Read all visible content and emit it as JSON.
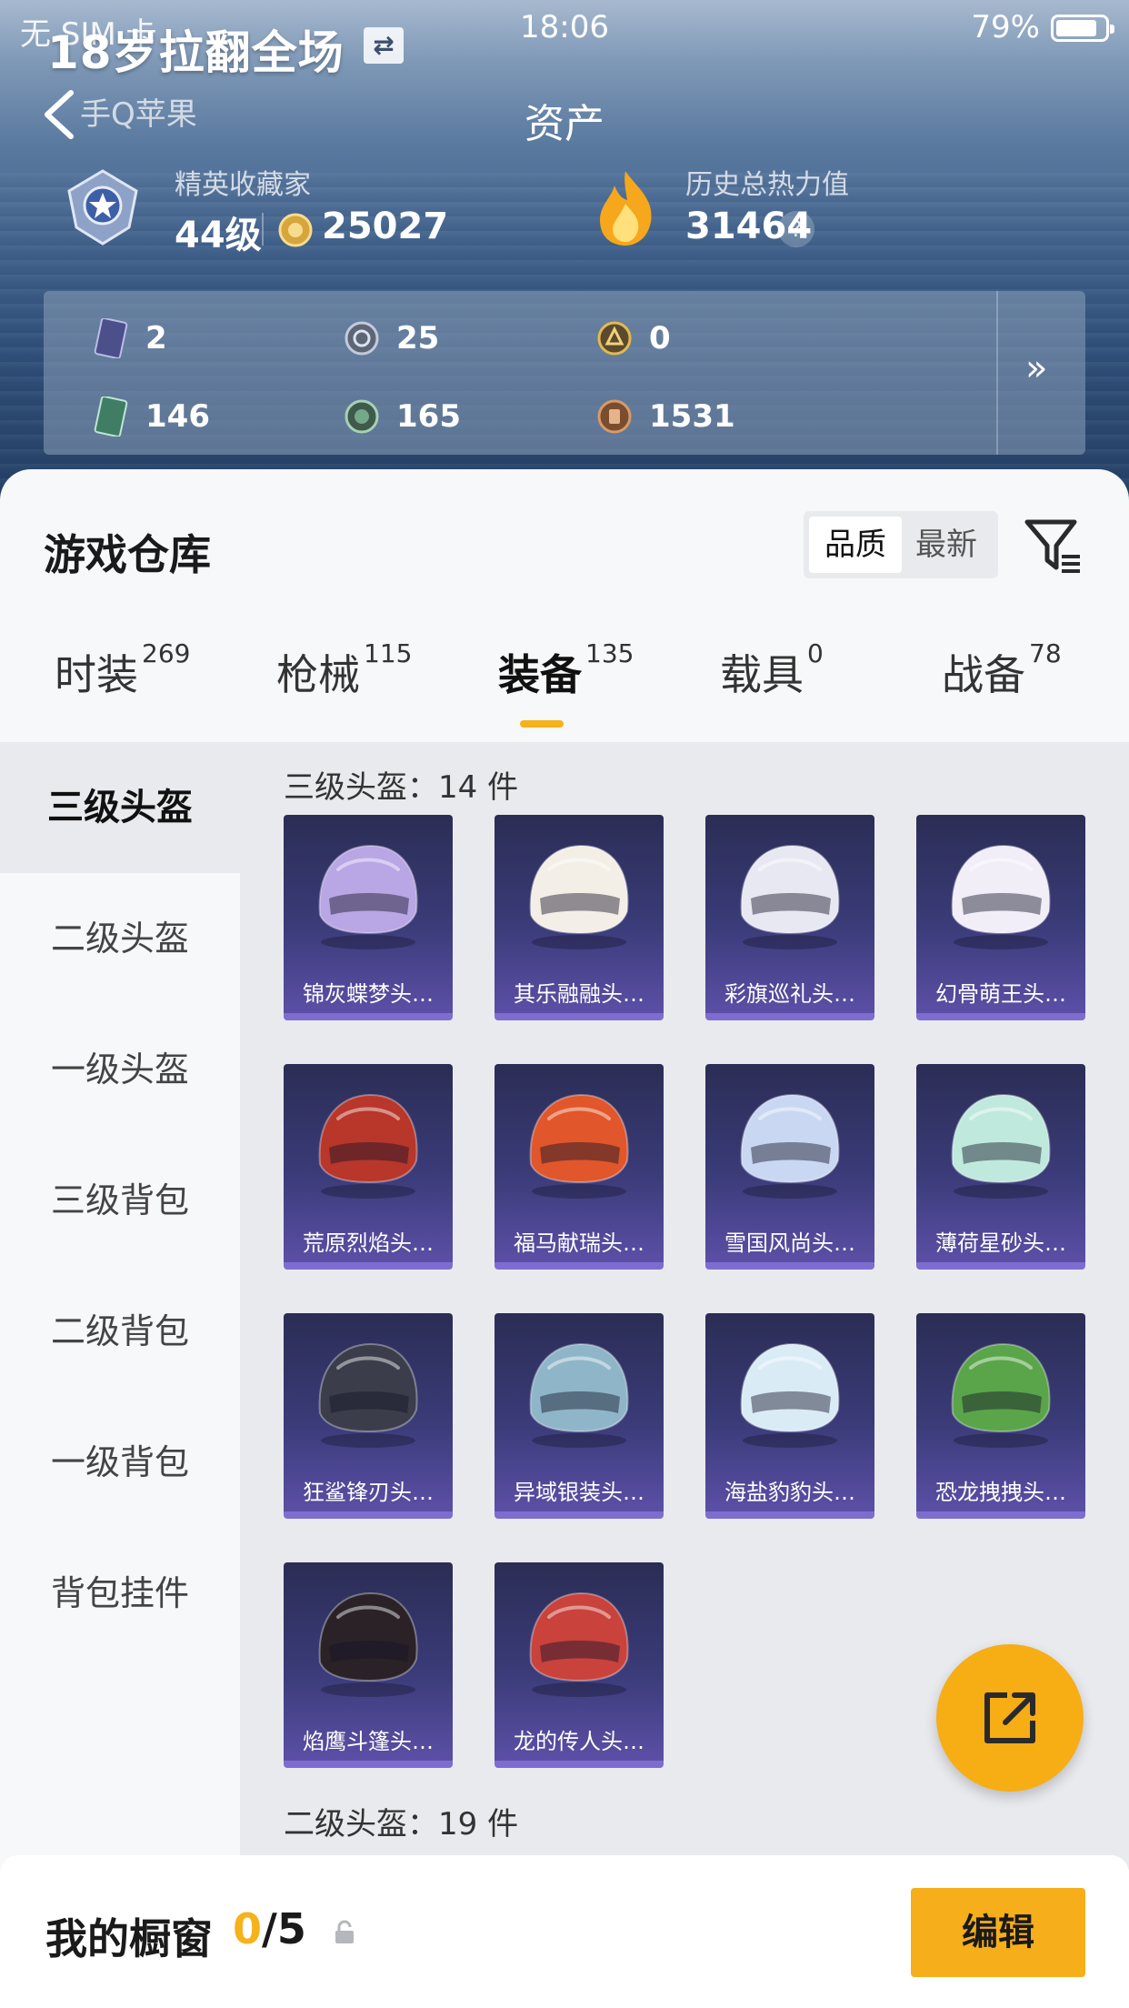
{
  "status_bar": {
    "carrier": "无 SIM 卡",
    "time": "18:06",
    "battery_pct": "79%",
    "battery_level": 0.79
  },
  "header": {
    "player_name": "18岁拉翻全场",
    "sub_platform": "手Q苹果",
    "sub_server": "",
    "page_title": "资产"
  },
  "rank": {
    "label": "精英收藏家",
    "level": "44级",
    "coins": "25027"
  },
  "heat": {
    "label": "历史总热力值",
    "value": "31464",
    "help": "?"
  },
  "currencies": [
    {
      "icon": "purple-card-icon",
      "value": "2"
    },
    {
      "icon": "silver-coin-icon",
      "value": "25"
    },
    {
      "icon": "gold-coin-icon",
      "value": "0"
    },
    {
      "icon": "green-card-icon",
      "value": "146"
    },
    {
      "icon": "green-coin-icon",
      "value": "165"
    },
    {
      "icon": "bronze-coin-icon",
      "value": "1531"
    }
  ],
  "more_arrows": "»",
  "warehouse": {
    "title": "游戏仓库",
    "sort_options": [
      "品质",
      "最新"
    ],
    "active_sort": "品质"
  },
  "tabs": [
    {
      "label": "时装",
      "count": "269"
    },
    {
      "label": "枪械",
      "count": "115"
    },
    {
      "label": "装备",
      "count": "135",
      "active": true
    },
    {
      "label": "载具",
      "count": "0"
    },
    {
      "label": "战备",
      "count": "78"
    }
  ],
  "sidebar": {
    "items": [
      {
        "label": "三级头盔",
        "active": true
      },
      {
        "label": "二级头盔"
      },
      {
        "label": "一级头盔"
      },
      {
        "label": "三级背包"
      },
      {
        "label": "二级背包"
      },
      {
        "label": "一级背包"
      },
      {
        "label": "背包挂件"
      }
    ]
  },
  "sections": [
    {
      "title": "三级头盔：14 件"
    },
    {
      "title": "二级头盔：19 件"
    }
  ],
  "items": [
    {
      "name": "锦灰蝶梦头…",
      "color": "#b9a6e4"
    },
    {
      "name": "其乐融融头…",
      "color": "#f3efe6"
    },
    {
      "name": "彩旗巡礼头…",
      "color": "#e8e8f2"
    },
    {
      "name": "幻骨萌王头…",
      "color": "#f1eef8"
    },
    {
      "name": "荒原烈焰头…",
      "color": "#b8362a"
    },
    {
      "name": "福马献瑞头…",
      "color": "#e1562a"
    },
    {
      "name": "雪国风尚头…",
      "color": "#c9d7f3"
    },
    {
      "name": "薄荷星砂头…",
      "color": "#bfe9dc"
    },
    {
      "name": "狂鲨锋刃头…",
      "color": "#3b3e4a"
    },
    {
      "name": "异域银装头…",
      "color": "#8fb6c8"
    },
    {
      "name": "海盐豹豹头…",
      "color": "#d9ecf6"
    },
    {
      "name": "恐龙拽拽头…",
      "color": "#5aa54a"
    },
    {
      "name": "焰鹰斗篷头…",
      "color": "#2a2226"
    },
    {
      "name": "龙的传人头…",
      "color": "#c9423c"
    }
  ],
  "showcase": {
    "label": "我的橱窗",
    "current": "0",
    "total": "/5",
    "edit_label": "编辑"
  },
  "colors": {
    "accent": "#f6b21b",
    "card_bottom": "#7e6cd0"
  }
}
